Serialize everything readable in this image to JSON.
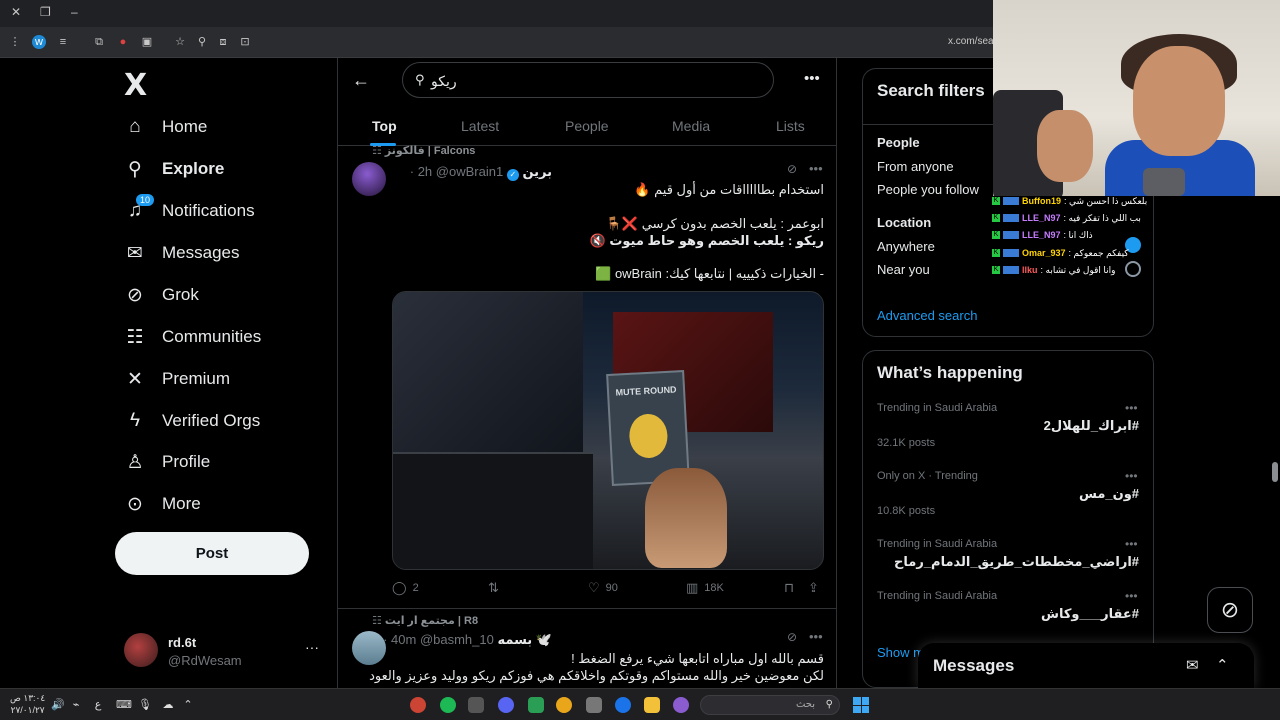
{
  "browser": {
    "url": "x.com/sear",
    "window_controls": [
      "✕",
      "❐",
      "–"
    ]
  },
  "nav": {
    "logo": "X",
    "items": [
      {
        "label": "Home",
        "icon": "home-icon",
        "glyph": "⌂"
      },
      {
        "label": "Explore",
        "icon": "search-icon",
        "glyph": "⚲"
      },
      {
        "label": "Notifications",
        "icon": "bell-icon",
        "glyph": "♫",
        "badge": "10"
      },
      {
        "label": "Messages",
        "icon": "envelope-icon",
        "glyph": "✉"
      },
      {
        "label": "Grok",
        "icon": "grok-icon",
        "glyph": "⊘"
      },
      {
        "label": "Communities",
        "icon": "communities-icon",
        "glyph": "☷"
      },
      {
        "label": "Premium",
        "icon": "x-premium-icon",
        "glyph": "✕"
      },
      {
        "label": "Verified Orgs",
        "icon": "lightning-icon",
        "glyph": "ϟ"
      },
      {
        "label": "Profile",
        "icon": "person-icon",
        "glyph": "♙"
      },
      {
        "label": "More",
        "icon": "more-circle-icon",
        "glyph": "⊙"
      }
    ],
    "post_label": "Post",
    "account": {
      "name": "rd.6t",
      "handle": "@RdWesam",
      "more": "···"
    }
  },
  "main": {
    "search_value": "ريكو",
    "tabs": [
      "Top",
      "Latest",
      "People",
      "Media",
      "Lists"
    ],
    "tweets": [
      {
        "community": "فالكونز | Falcons",
        "display_name": "برين",
        "handle": "@owBrain1",
        "time": "· 2h",
        "lines": [
          "استخدام بطاااااقات من أول قيم 🔥",
          "ابوعمر : يلعب الخصم بدون كرسي ❌🪑",
          "ريكو : يلعب الخصم وهو حاط ميوت 🔇",
          "- الخيارات ذكيييه | نتابعها كيك: owBrain 🟩"
        ],
        "media_text": "MUTE ROUND",
        "actions": {
          "replies": "2",
          "reposts": "",
          "likes": "90",
          "views": "18K"
        }
      },
      {
        "community": "مجتمع ار ايت | R8",
        "display_name": "بسمه 🕊️",
        "handle": "@basmh_10",
        "time": "· 40m",
        "lines": [
          "قسم بالله اول مباراه اتابعها شيء يرفع الضغط !",
          "لكن معوضين خير والله مستواكم وقوتكم واخلاقكم هي فوزكم ريكو ووليد وعزيز والعود"
        ]
      }
    ]
  },
  "filters": {
    "title": "Search filters",
    "people_label": "People",
    "people_options": [
      "From anyone",
      "People you follow"
    ],
    "location_label": "Location",
    "location_options": [
      "Anywhere",
      "Near you"
    ],
    "advanced": "Advanced search"
  },
  "happening": {
    "title": "What’s happening",
    "trends": [
      {
        "context": "Trending in Saudi Arabia",
        "name": "#ابراك_للهلال2",
        "posts": "32.1K posts"
      },
      {
        "context": "Only on X · Trending",
        "name": "#ون_مس",
        "posts": "10.8K posts"
      },
      {
        "context": "Trending in Saudi Arabia",
        "name": "#اراضي_مخططات_طريق_الدمام_رماح",
        "posts": ""
      },
      {
        "context": "Trending in Saudi Arabia",
        "name": "#عقار___وكاش",
        "posts": ""
      }
    ],
    "show_more": "Show m"
  },
  "chat_overlay": [
    {
      "user": "Buffon19",
      "text": "بلعكس ذا احسن شي :",
      "color": "#ffd400"
    },
    {
      "user": "LLE_N97",
      "text": "بب اللي ذا تفكر فيه :",
      "color": "#c77dff"
    },
    {
      "user": "LLE_N97",
      "text": "ذاك انا :",
      "color": "#c77dff"
    },
    {
      "user": "Omar_937",
      "text": "كيفكم جمعوكم :",
      "color": "#ffd400"
    },
    {
      "user": "llku",
      "text": "وانا اقول في تشابه :",
      "color": "#ff5a5a"
    }
  ],
  "messages_drawer": {
    "title": "Messages"
  },
  "taskbar": {
    "search_placeholder": "بحث",
    "clock_time": "١٣:٠٤ ص",
    "clock_date": "٢٧/٠١/٢٧",
    "lang": "ع"
  }
}
